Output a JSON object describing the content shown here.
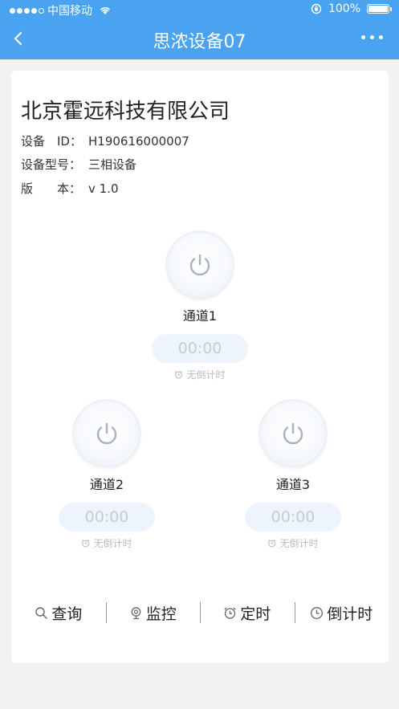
{
  "status_bar": {
    "carrier": "中国移动",
    "battery": "100%"
  },
  "nav": {
    "title": "思浓设备07"
  },
  "device": {
    "company": "北京霍远科技有限公司",
    "id_label": "设备　ID：",
    "id_value": "H190616000007",
    "model_label": "设备型号：",
    "model_value": "三相设备",
    "version_label": "版　　本：",
    "version_value": "v 1.0"
  },
  "channels": [
    {
      "name": "通道1",
      "timer": "00:00",
      "countdown": "无倒计时"
    },
    {
      "name": "通道2",
      "timer": "00:00",
      "countdown": "无倒计时"
    },
    {
      "name": "通道3",
      "timer": "00:00",
      "countdown": "无倒计时"
    }
  ],
  "toolbar": {
    "query": "查询",
    "monitor": "监控",
    "schedule": "定时",
    "countdown": "倒计时"
  },
  "icons": {
    "back": "chevron-left-icon",
    "more": "more-dots-icon",
    "power": "power-icon",
    "alarm": "alarm-clock-icon",
    "search": "search-icon",
    "camera": "camera-icon",
    "clock": "clock-icon"
  },
  "colors": {
    "header": "#4aa3f0",
    "timer_bg": "#eef4fb",
    "muted": "#b6bcc4"
  }
}
